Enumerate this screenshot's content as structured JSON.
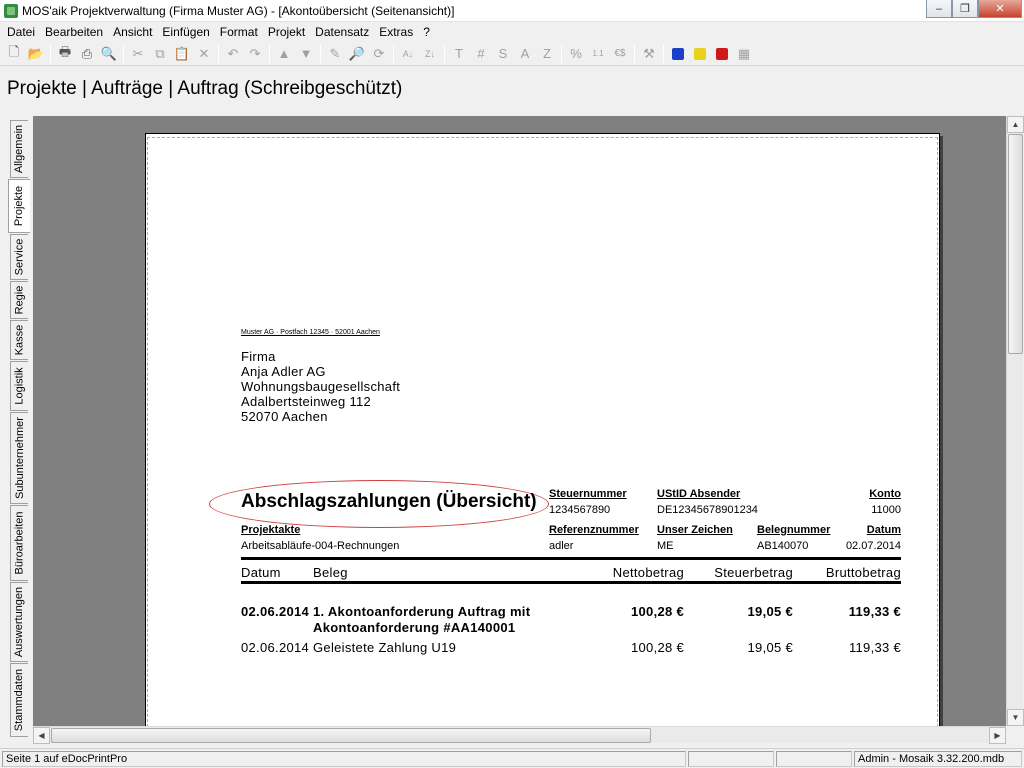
{
  "window": {
    "title": "MOS'aik Projektverwaltung (Firma Muster AG) - [Akontoübersicht (Seitenansicht)]",
    "minimize": "–",
    "restore": "❐",
    "close": "✕"
  },
  "menu": [
    "Datei",
    "Bearbeiten",
    "Ansicht",
    "Einfügen",
    "Format",
    "Projekt",
    "Datensatz",
    "Extras",
    "?"
  ],
  "toolbar": {
    "new": "🗋",
    "open": "📂",
    "print": "🖶",
    "print2": "⎙",
    "preview": "🔍",
    "cut": "✂",
    "copy": "⧉",
    "paste": "📋",
    "delete": "✕",
    "undo": "↶",
    "redo": "↷",
    "up": "▲",
    "down": "▼",
    "pen": "✎",
    "find": "🔎",
    "refresh": "⟳",
    "sort_asc": "A↓",
    "sort_desc": "Z↓",
    "fmt_t": "T",
    "fmt_hash": "#",
    "fmt_s": "S",
    "fmt_a": "A",
    "fmt_z": "Z",
    "fmt_percent": "%",
    "fmt_num": "1.1",
    "fmt_currency": "€$",
    "tool": "⚒",
    "colors": {
      "blue": "#1c3fc9",
      "yellow": "#e8d21e",
      "red": "#d01818"
    }
  },
  "breadcrumb": "Projekte | Aufträge | Auftrag (Schreibgeschützt)",
  "sidetabs": [
    "Allgemein",
    "Projekte",
    "Service",
    "Regie",
    "Kasse",
    "Logistik",
    "Subunternehmer",
    "Büroarbeiten",
    "Auswertungen",
    "Stammdaten"
  ],
  "active_tab": "Projekte",
  "document": {
    "sender_line": "Muster AG · Postfach 12345 · 52001 Aachen",
    "address": [
      "Firma",
      "Anja Adler AG",
      "Wohnungsbaugesellschaft",
      "Adalbertsteinweg 112",
      "52070 Aachen"
    ],
    "title": "Abschlagszahlungen (Übersicht)",
    "header_fields": {
      "steuernummer_label": "Steuernummer",
      "steuernummer": "1234567890",
      "ustid_label": "UStID Absender",
      "ustid": "DE12345678901234",
      "konto_label": "Konto",
      "konto": "11000",
      "projektakte_label": "Projektakte",
      "projektakte": "Arbeitsabläufe-004-Rechnungen",
      "referenz_label": "Referenznummer",
      "referenz": "adler",
      "zeichen_label": "Unser Zeichen",
      "zeichen": "ME",
      "beleg_label": "Belegnummer",
      "beleg": "AB140070",
      "datum_label": "Datum",
      "datum": "02.07.2014"
    },
    "columns": [
      "Datum",
      "Beleg",
      "Nettobetrag",
      "Steuerbetrag",
      "Bruttobetrag"
    ],
    "rows": [
      {
        "datum": "02.06.2014",
        "beleg_line1": "1. Akontoanforderung Auftrag mit",
        "beleg_line2": "Akontoanforderung #AA140001",
        "netto": "100,28 €",
        "steuer": "19,05 €",
        "brutto": "119,33 €"
      },
      {
        "datum": "02.06.2014",
        "beleg_line1": "Geleistete Zahlung U19",
        "netto": "100,28 €",
        "steuer": "19,05 €",
        "brutto": "119,33 €"
      }
    ]
  },
  "statusbar": {
    "left": "Seite 1 auf eDocPrintPro",
    "right": "Admin - Mosaik 3.32.200.mdb"
  }
}
